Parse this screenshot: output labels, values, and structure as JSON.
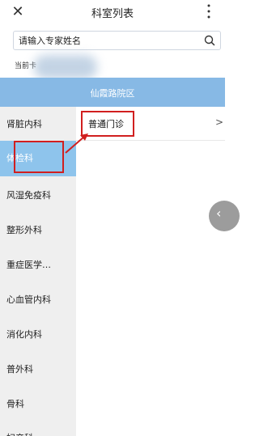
{
  "header": {
    "title": "科室列表",
    "close_icon": "close-icon",
    "more_icon": "more-options-icon"
  },
  "search": {
    "placeholder": "请输入专家姓名",
    "icon": "search-icon"
  },
  "current_label": "当前卡",
  "hospital": {
    "name": "仙霞路院区"
  },
  "departments": [
    {
      "label": "肾脏内科",
      "active": false
    },
    {
      "label": "体检科",
      "active": true
    },
    {
      "label": "风湿免疫科",
      "active": false
    },
    {
      "label": "整形外科",
      "active": false
    },
    {
      "label": "重症医学…",
      "active": false
    },
    {
      "label": "心血管内科",
      "active": false
    },
    {
      "label": "消化内科",
      "active": false
    },
    {
      "label": "普外科",
      "active": false
    },
    {
      "label": "骨科",
      "active": false
    },
    {
      "label": "妇产科",
      "active": false
    }
  ],
  "clinics": [
    {
      "label": "普通门诊",
      "chevron": ">"
    }
  ],
  "colors": {
    "accent": "#87b9e5",
    "active_item": "#8ec4ec",
    "annotation": "#d11f1f"
  }
}
